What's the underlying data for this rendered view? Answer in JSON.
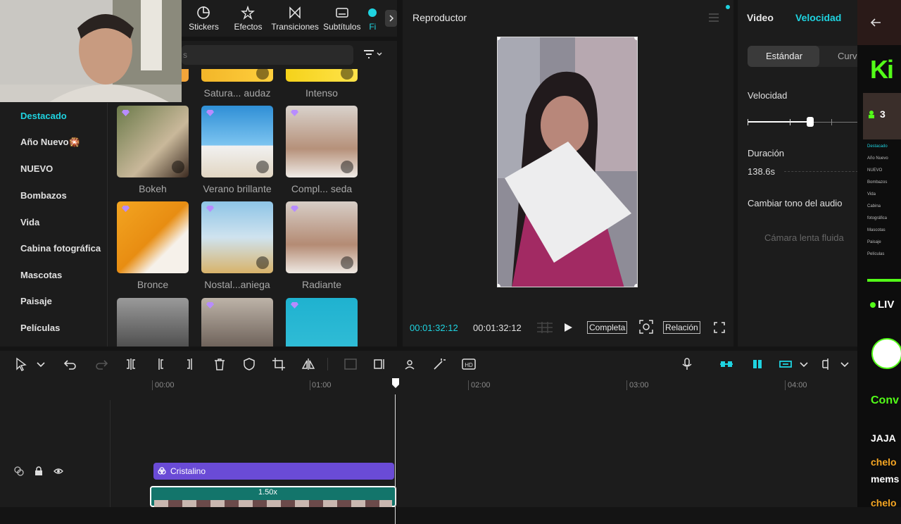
{
  "toolbar_tabs": [
    {
      "label": "Stickers",
      "icon": "stickers-icon"
    },
    {
      "label": "Efectos",
      "icon": "effects-icon"
    },
    {
      "label": "Transiciones",
      "icon": "transitions-icon"
    },
    {
      "label": "Subtítulos",
      "icon": "subtitles-icon"
    },
    {
      "label": "Fi",
      "icon": "filters-icon"
    }
  ],
  "search": {
    "placeholder": "s"
  },
  "categories": [
    {
      "label": "Destacado",
      "active": true
    },
    {
      "label": "Año Nuevo🎇"
    },
    {
      "label": "NUEVO"
    },
    {
      "label": "Bombazos"
    },
    {
      "label": "Vida"
    },
    {
      "label": "Cabina fotográfica"
    },
    {
      "label": "Mascotas"
    },
    {
      "label": "Paisaje"
    },
    {
      "label": "Películas"
    }
  ],
  "effect_cards": [
    {
      "label": "Satura... audaz"
    },
    {
      "label": "Intenso"
    },
    {
      "label": "Bokeh"
    },
    {
      "label": "Verano brillante"
    },
    {
      "label": "Compl... seda"
    },
    {
      "label": "Bronce"
    },
    {
      "label": "Nostal...aniega"
    },
    {
      "label": "Radiante"
    }
  ],
  "player": {
    "title": "Reproductor",
    "time_current": "00:01:32:12",
    "time_total": "00:01:32:12",
    "btn_full": "Completa",
    "btn_ratio": "Relación"
  },
  "props": {
    "tab_video": "Video",
    "tab_speed": "Velocidad",
    "seg_standard": "Estándar",
    "seg_curve": "Curva",
    "speed_label": "Velocidad",
    "duration_label": "Duración",
    "duration_value": "138.6s",
    "pitch_label": "Cambiar tono del audio",
    "smooth_label": "Cámara lenta fluida"
  },
  "timeline": {
    "ruler_labels": [
      "00:00",
      "01:00",
      "02:00",
      "03:00",
      "04:00"
    ],
    "effect_clip_label": "Cristalino",
    "speed_badge": "1.50x"
  },
  "chat": {
    "brand": "Ki",
    "viewers": "3",
    "live_label": "LIV",
    "conv_label": "Conv",
    "msg1": "JAJA",
    "user1": "chelo",
    "msg2": "mems",
    "user2": "chelo",
    "mini_categories": [
      "Destacado",
      "Año Nuevo",
      "NUEVO",
      "Bombazos",
      "Vida",
      "Cabina fotográfica",
      "Mascotas",
      "Paisaje",
      "Películas"
    ]
  },
  "colors": {
    "accent": "#1fd3e0",
    "panel": "#1c1c1c",
    "effect_clip": "#6a4bd6",
    "video_clip": "#13756b",
    "kick_green": "#53fc18"
  }
}
